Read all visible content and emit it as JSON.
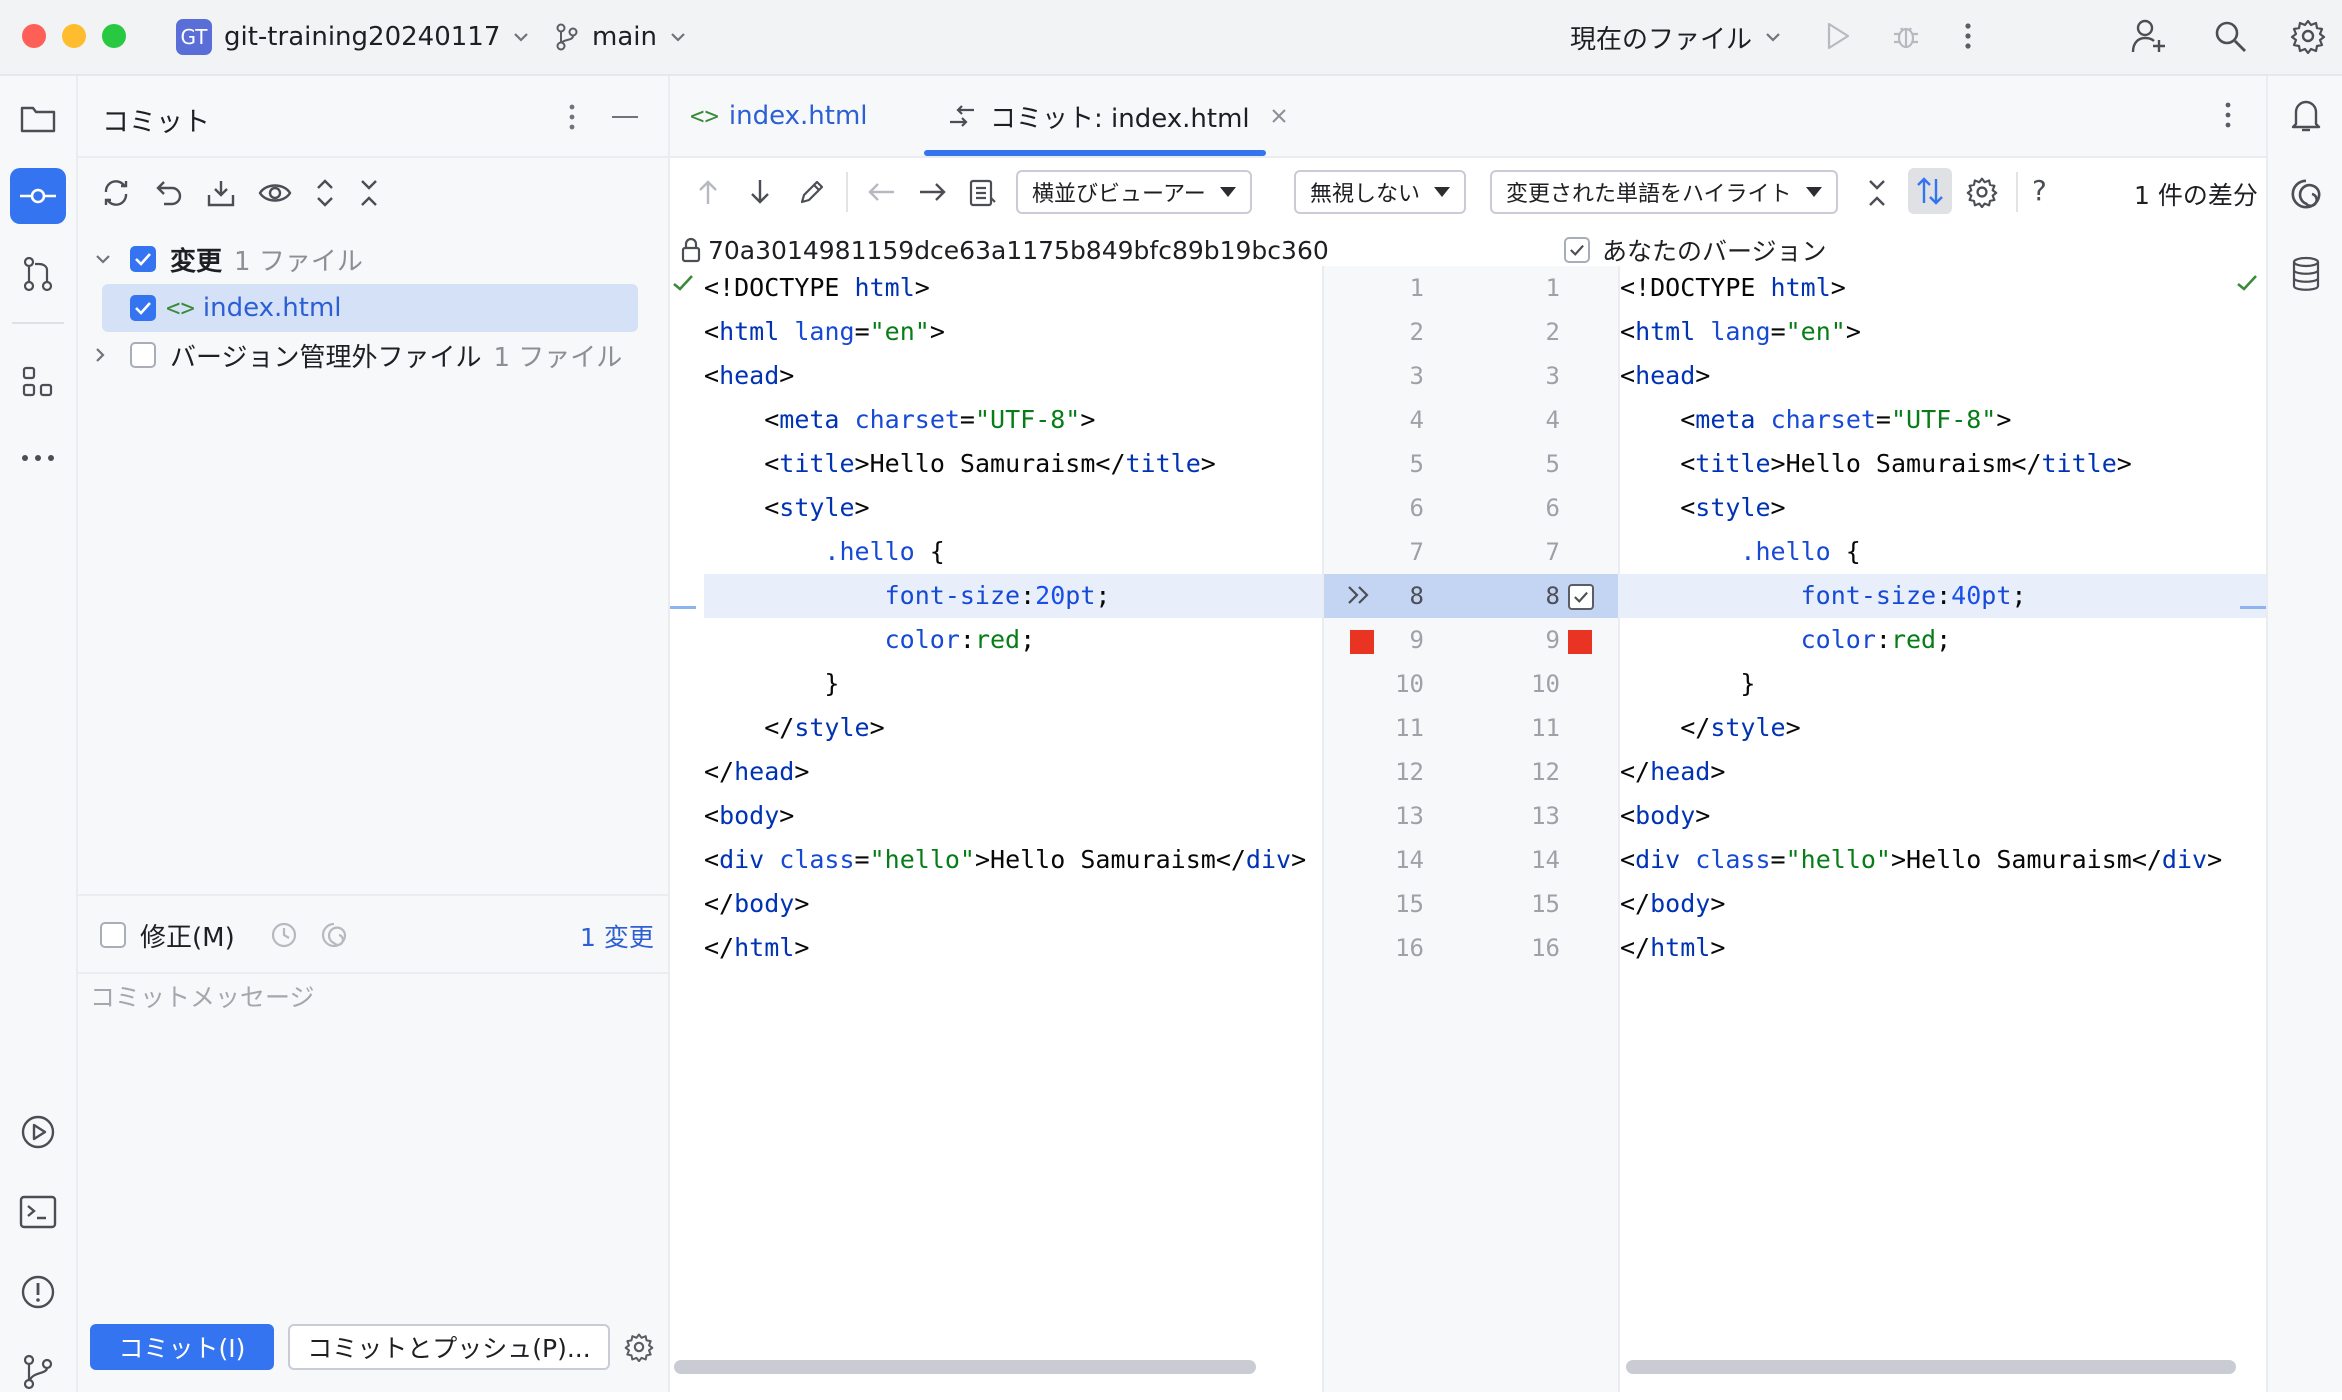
{
  "titlebar": {
    "project_badge": "GT",
    "project_name": "git-training20240117",
    "branch": "main",
    "run_config": "現在のファイル"
  },
  "commit_panel": {
    "title": "コミット",
    "tree": {
      "changes_label": "変更",
      "changes_count": "1 ファイル",
      "file_name": "index.html",
      "unversioned_label": "バージョン管理外ファイル",
      "unversioned_count": "1 ファイル"
    },
    "amend_label": "修正(M)",
    "changes_link": "1 変更",
    "message_placeholder": "コミットメッセージ",
    "commit_button": "コミット(I)",
    "commit_push_button": "コミットとプッシュ(P)..."
  },
  "tabs": [
    {
      "label": "index.html",
      "icon": "html-icon"
    },
    {
      "label": "コミット: index.html",
      "icon": "diff-icon"
    }
  ],
  "diff_toolbar": {
    "viewer_mode": "横並びビューアー",
    "ignore_mode": "無視しない",
    "highlight_mode": "変更された単語をハイライト",
    "diff_count": "1 件の差分",
    "help": "?"
  },
  "diff": {
    "left_header": "70a3014981159dce63a1175b849bfc89b19bc360",
    "right_header": "あなたのバージョン",
    "left_lines": [
      "<!DOCTYPE html>",
      "<html lang=\"en\">",
      "<head>",
      "    <meta charset=\"UTF-8\">",
      "    <title>Hello Samuraism</title>",
      "    <style>",
      "        .hello {",
      "            font-size:20pt;",
      "            color:red;",
      "        }",
      "    </style>",
      "</head>",
      "<body>",
      "<div class=\"hello\">Hello Samuraism</div>",
      "</body>",
      "</html>"
    ],
    "right_lines": [
      "<!DOCTYPE html>",
      "<html lang=\"en\">",
      "<head>",
      "    <meta charset=\"UTF-8\">",
      "    <title>Hello Samuraism</title>",
      "    <style>",
      "        .hello {",
      "            font-size:40pt;",
      "            color:red;",
      "        }",
      "    </style>",
      "</head>",
      "<body>",
      "<div class=\"hello\">Hello Samuraism</div>",
      "</body>",
      "</html>"
    ],
    "line_numbers": [
      "1",
      "2",
      "3",
      "4",
      "5",
      "6",
      "7",
      "8",
      "9",
      "10",
      "11",
      "12",
      "13",
      "14",
      "15",
      "16"
    ],
    "changed_line": 8
  },
  "colors": {
    "accent": "#3574f0",
    "changed_bg": "#e8eefa",
    "breakpoint": "#e93323"
  }
}
